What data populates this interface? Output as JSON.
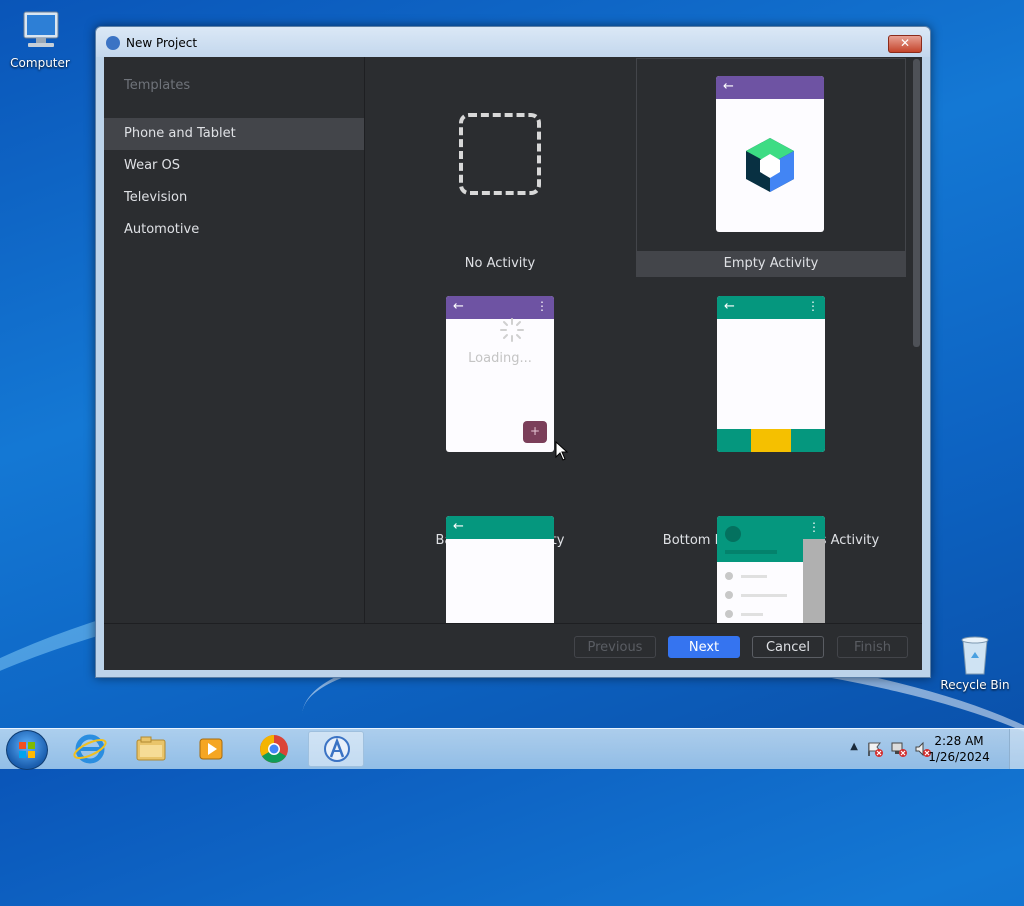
{
  "desktop": {
    "icons": [
      {
        "label": "Computer"
      },
      {
        "label": "Recycle Bin"
      }
    ]
  },
  "window": {
    "title": "New Project",
    "close_glyph": "✕"
  },
  "sidebar": {
    "header": "Templates",
    "items": [
      {
        "label": "Phone and Tablet",
        "selected": true
      },
      {
        "label": "Wear OS"
      },
      {
        "label": "Television"
      },
      {
        "label": "Automotive"
      }
    ]
  },
  "templates": [
    {
      "label": "No Activity"
    },
    {
      "label": "Empty Activity",
      "selected": true
    },
    {
      "label": "Basic Views Activity",
      "loading_text": "Loading...",
      "fab": "+"
    },
    {
      "label": "Bottom Navigation Views Activity"
    },
    {
      "label": ""
    },
    {
      "label": ""
    }
  ],
  "buttons": {
    "previous": "Previous",
    "next": "Next",
    "cancel": "Cancel",
    "finish": "Finish"
  },
  "taskbar": {
    "time": "2:28 AM",
    "date": "1/26/2024"
  },
  "colors": {
    "purple": "#6e53a3",
    "teal": "#05977e",
    "accent": "#3574f0",
    "yellow": "#f5c000"
  }
}
